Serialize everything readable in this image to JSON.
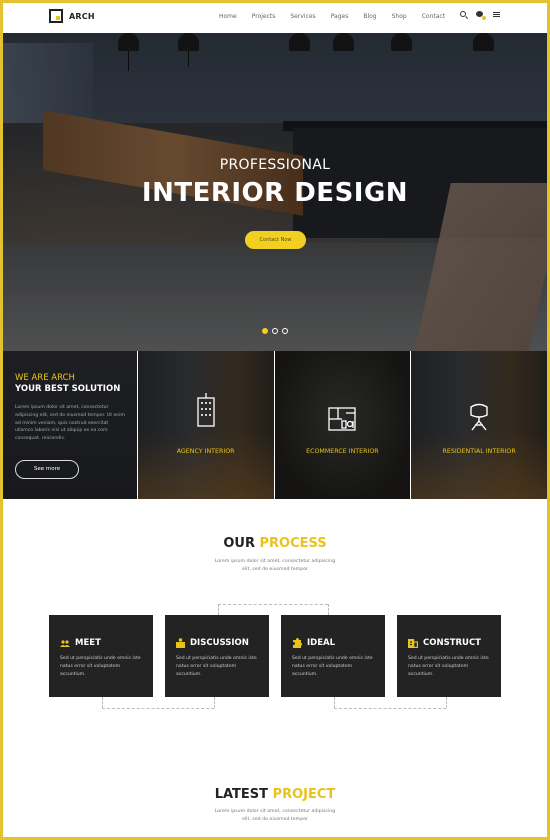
{
  "header": {
    "brand": "ARCH",
    "nav": [
      "Home",
      "Projects",
      "Services",
      "Pages",
      "Blog",
      "Shop",
      "Contact"
    ],
    "icons": [
      "search-icon",
      "chat-icon",
      "menu-icon"
    ]
  },
  "hero": {
    "subtitle": "PROFESSIONAL",
    "title": "INTERIOR DESIGN",
    "button": "Contact Now",
    "slides": 3,
    "active_slide": 1
  },
  "intro": {
    "kicker": "WE ARE ARCH",
    "heading": "YOUR BEST SOLUTION",
    "text": "Lorem ipsum dolor sit amet, consectetur adipiscing elit, sed do eiusmod tempor. Ut enim ad minim veniam, quis nostrud exercitat ullamco laboris nisi ut aliquip ex ea com consequat. reiciendis.",
    "button": "See more"
  },
  "services": [
    {
      "label": "AGENCY INTERIOR",
      "icon": "building-icon"
    },
    {
      "label": "ECOMMERCE INTERIOR",
      "icon": "floorplan-icon"
    },
    {
      "label": "RESIDENTIAL INTERIOR",
      "icon": "chair-icon"
    }
  ],
  "process": {
    "title_main": "OUR",
    "title_highlight": "PROCESS",
    "subtitle_line1": "Lorem ipsum dolor sit amet, consectetur adipiscing",
    "subtitle_line2": "elit, sed do eiusmod tempor",
    "steps": [
      {
        "title": "MEET",
        "icon": "users-icon",
        "text": "Sed ut perspiciatis unde omnis iste natus error sit voluptatem accuntium."
      },
      {
        "title": "DISCUSSION",
        "icon": "discussion-icon",
        "text": "Sed ut perspiciatis unde omnis iste natus error sit voluptatem accuntium."
      },
      {
        "title": "IDEAL",
        "icon": "puzzle-icon",
        "text": "Sed ut perspiciatis unde omnis iste natus error sit voluptatem accuntium."
      },
      {
        "title": "CONSTRUCT",
        "icon": "construct-icon",
        "text": "Sed ut perspiciatis unde omnis iste natus error sit voluptatem accuntium."
      }
    ]
  },
  "latest": {
    "title_main": "LATEST",
    "title_highlight": "PROJECT",
    "subtitle_line1": "Lorem ipsum dolor sit amet, consectetur adipiscing",
    "subtitle_line2": "elit, sed do eiusmod tempor"
  },
  "colors": {
    "accent": "#e8c31c",
    "dark": "#232323",
    "frame": "#e2c22e"
  }
}
